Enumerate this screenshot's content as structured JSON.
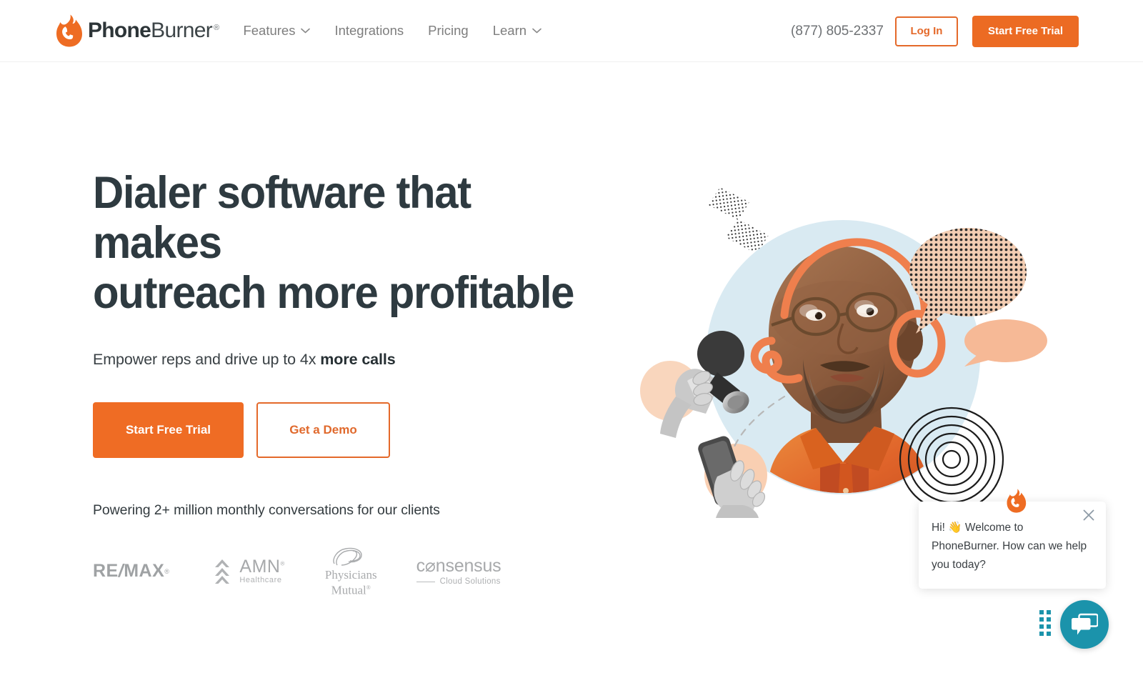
{
  "header": {
    "logo": {
      "icon": "flame-phone-icon",
      "name_bold": "Phone",
      "name_light": "Burner",
      "trademark": "®"
    },
    "nav": [
      {
        "label": "Features",
        "has_dropdown": true,
        "icon": "chevron-down-icon"
      },
      {
        "label": "Integrations",
        "has_dropdown": false
      },
      {
        "label": "Pricing",
        "has_dropdown": false
      },
      {
        "label": "Learn",
        "has_dropdown": true,
        "icon": "chevron-down-icon"
      }
    ],
    "phone": "(877) 805-2337",
    "login_label": "Log In",
    "trial_label": "Start Free Trial"
  },
  "hero": {
    "title_line1": "Dialer software that makes",
    "title_line2": "outreach more profitable",
    "subtitle_prefix": "Empower reps and drive up to 4x ",
    "subtitle_bold": "more calls",
    "primary_cta": "Start Free Trial",
    "secondary_cta": "Get a Demo",
    "social_proof": "Powering 2+ million monthly conversations for our clients",
    "client_logos": [
      {
        "name": "RE/MAX",
        "part1": "RE",
        "slash": "/",
        "part2": "MAX",
        "trademark": "®"
      },
      {
        "name": "AMN Healthcare",
        "title": "AMN",
        "trademark": "®",
        "subtitle": "Healthcare"
      },
      {
        "name": "Physicians Mutual",
        "line1": "Physicians",
        "line2": "Mutual",
        "trademark": "®"
      },
      {
        "name": "consensus Cloud Solutions",
        "title": "c⌀nsensus",
        "subtitle": "Cloud Solutions"
      }
    ],
    "illustration": {
      "alt": "Man with headset illustration collage",
      "elements": [
        "light-blue-circle",
        "man-photo",
        "orange-headset-outline",
        "halftone-speech-bubble",
        "peach-speech-bubble",
        "hand-holding-handset",
        "hand-holding-phone",
        "concentric-circles",
        "halftone-zigzag",
        "dashed-curve"
      ]
    }
  },
  "chat": {
    "message": "Hi! 👋 Welcome to PhoneBurner. How can we help you today?",
    "close_icon": "close-icon",
    "avatar_icon": "flame-avatar-icon",
    "fab_icon": "chat-bubbles-icon",
    "grip_icon": "drag-grip-icon"
  },
  "colors": {
    "brand_orange": "#ec6b23",
    "cta_orange": "#ef6c24",
    "heading": "#2e3a40",
    "nav_gray": "#7e7e7e",
    "logo_gray": "#a7a9ab",
    "chat_teal": "#1b93ab",
    "art_light_blue": "#d9eaf2",
    "art_peach": "#f5b995",
    "art_shirt_orange": "#e0642a"
  }
}
